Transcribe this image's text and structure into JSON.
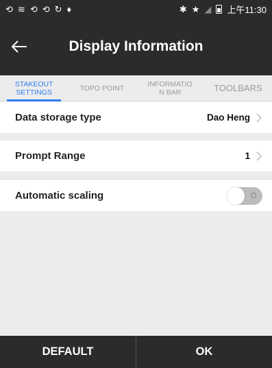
{
  "status_bar": {
    "left_icons": [
      "sync-icon",
      "wifi-off-icon",
      "sync-icon",
      "sync-icon",
      "refresh-icon",
      "location-pin-icon"
    ],
    "right_icons": [
      "bluetooth-icon",
      "star-icon",
      "signal-icon",
      "battery-icon"
    ],
    "time": "上午11:30"
  },
  "header": {
    "title": "Display Information"
  },
  "tabs": [
    {
      "label": "STAKEOUT SETTINGS",
      "active": true
    },
    {
      "label": "TOPO POINT",
      "active": false
    },
    {
      "label": "INFORMATIO N BAR",
      "active": false
    },
    {
      "label": "TOOLBARS",
      "active": false
    }
  ],
  "settings": {
    "data_storage_type": {
      "label": "Data storage type",
      "value": "Dao Heng"
    },
    "prompt_range": {
      "label": "Prompt Range",
      "value": "1"
    },
    "automatic_scaling": {
      "label": "Automatic scaling",
      "enabled": false
    }
  },
  "footer": {
    "default_label": "DEFAULT",
    "ok_label": "OK"
  },
  "colors": {
    "accent": "#2f7ef0",
    "bar": "#2b2b2b",
    "background": "#ececec"
  }
}
